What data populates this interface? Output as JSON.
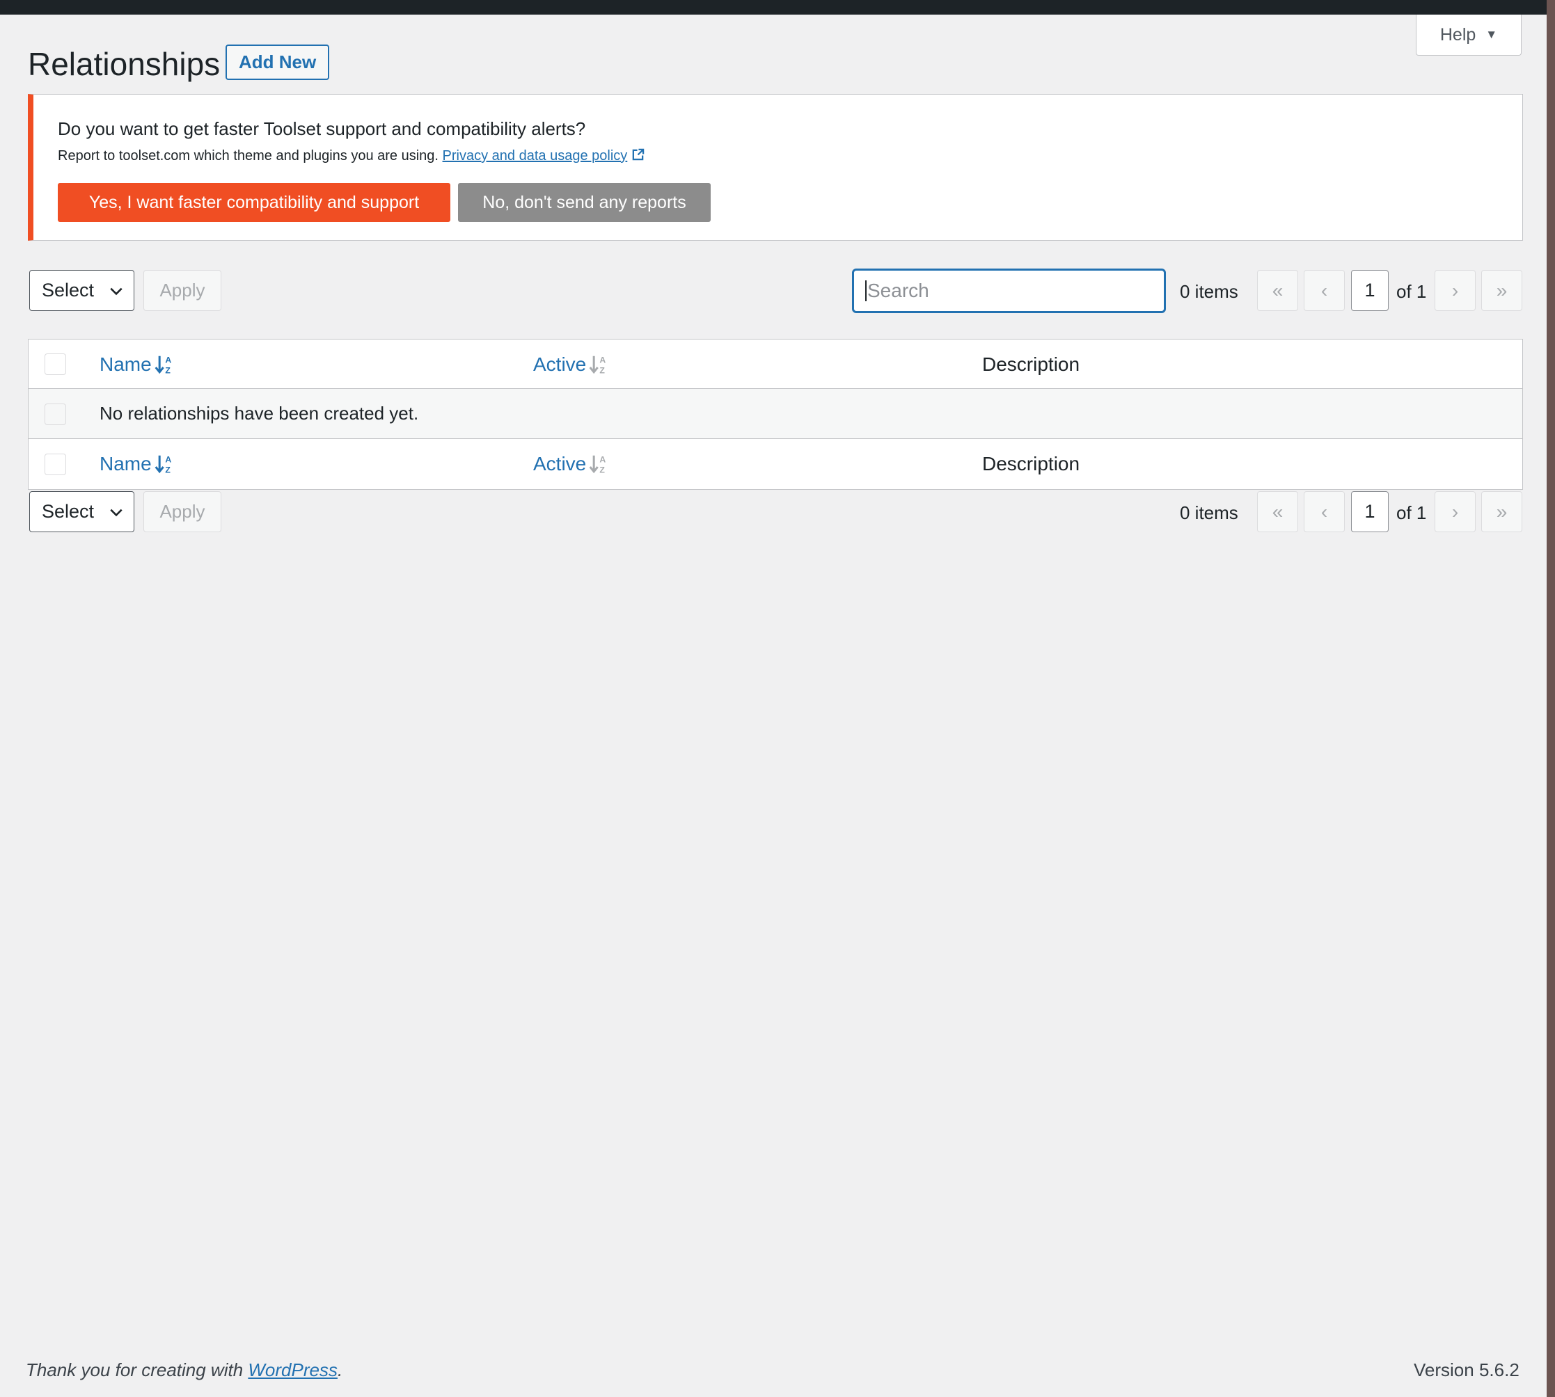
{
  "help_tab": {
    "label": "Help"
  },
  "header": {
    "title": "Relationships",
    "add_new_label": "Add New"
  },
  "notice": {
    "question": "Do you want to get faster Toolset support and compatibility alerts?",
    "report_text": "Report to toolset.com which theme and plugins you are using.",
    "policy_link": "Privacy and data usage policy",
    "yes_button": "Yes, I want faster compatibility and support",
    "no_button": "No, don't send any reports"
  },
  "top_nav": {
    "bulk_select": "Select",
    "apply_label": "Apply",
    "search_placeholder": "Search",
    "items_count": "0 items",
    "current_page": "1",
    "of_pages": "of 1"
  },
  "bottom_nav": {
    "bulk_select": "Select",
    "apply_label": "Apply",
    "items_count": "0 items",
    "current_page": "1",
    "of_pages": "of 1"
  },
  "pagination_glyphs": {
    "first": "«",
    "prev": "‹",
    "next": "›",
    "last": "»"
  },
  "table": {
    "columns": {
      "name": "Name",
      "active": "Active",
      "description": "Description"
    },
    "empty_message": "No relationships have been created yet."
  },
  "footer": {
    "thanks_prefix": "Thank you for creating with ",
    "thanks_link": "WordPress",
    "thanks_suffix": ".",
    "version": "Version 5.6.2"
  },
  "colors": {
    "accent": "#2271b1",
    "notice_accent": "#f04e23",
    "no_button": "#8c8c8c"
  }
}
